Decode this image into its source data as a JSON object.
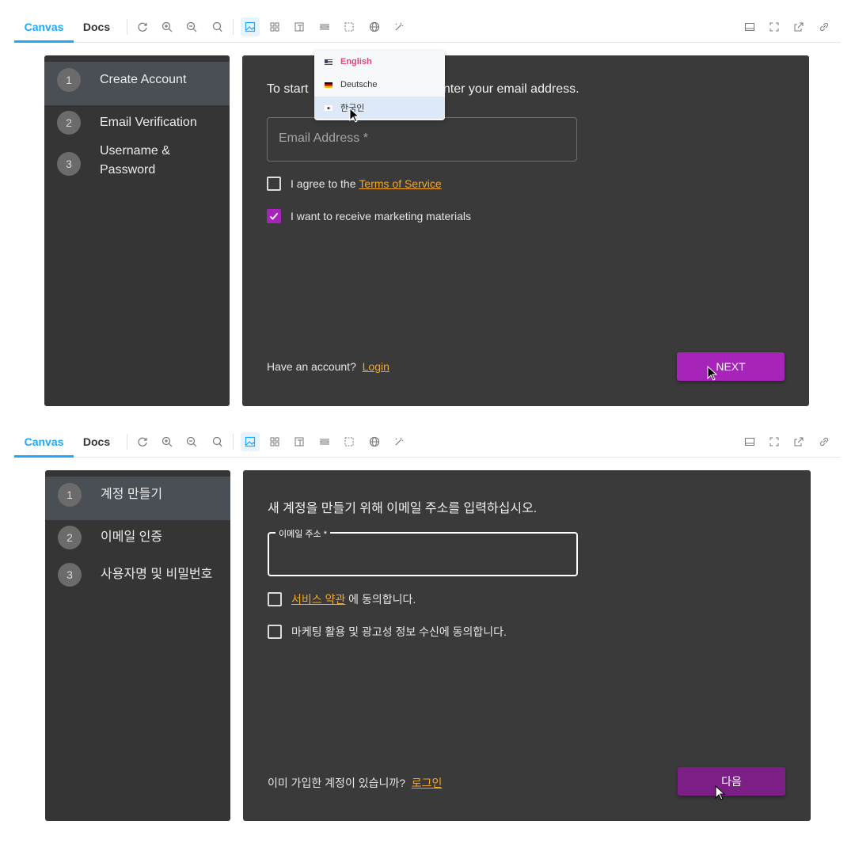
{
  "frame1": {
    "toolbar": {
      "tab_canvas": "Canvas",
      "tab_docs": "Docs"
    },
    "steps": [
      {
        "num": "1",
        "label": "Create Account"
      },
      {
        "num": "2",
        "label": "Email Verification"
      },
      {
        "num": "3",
        "label": "Username & Password"
      }
    ],
    "intro_left": "To start",
    "intro_right": "enter your email address.",
    "email_placeholder": "Email Address *",
    "terms_prefix": "I agree to the ",
    "terms_link": "Terms of Service",
    "marketing": "I want to receive marketing materials",
    "marketing_checked": true,
    "footer_text": "Have an account?",
    "login_link": "Login",
    "next_label": "NEXT",
    "language_menu": [
      {
        "label": "English",
        "flag": "us-flag",
        "selected": true
      },
      {
        "label": "Deutsche",
        "flag": "de-flag",
        "selected": false
      },
      {
        "label": "한국인",
        "flag": "kr-flag",
        "selected": false
      }
    ]
  },
  "frame2": {
    "toolbar": {
      "tab_canvas": "Canvas",
      "tab_docs": "Docs"
    },
    "steps": [
      {
        "num": "1",
        "label": "계정 만들기"
      },
      {
        "num": "2",
        "label": "이메일 인증"
      },
      {
        "num": "3",
        "label": "사용자명 및 비밀번호"
      }
    ],
    "intro": "새 계정을 만들기 위해 이메일 주소를 입력하십시오.",
    "email_label": "이메일 주소 *",
    "terms_link": "서비스 약관",
    "terms_suffix": " 에 동의합니다.",
    "marketing": "마케팅 활용 및 광고성 정보 수신에 동의합니다.",
    "marketing_checked": false,
    "footer_text": "이미 가입한 계정이 있습니까?",
    "login_link": "로그인",
    "next_label": "다음"
  },
  "colors": {
    "accent_blue": "#1ea7fd",
    "primary_purple": "#a624b8",
    "link_orange": "#f5a623",
    "panel_bg": "#3a3a3a"
  }
}
